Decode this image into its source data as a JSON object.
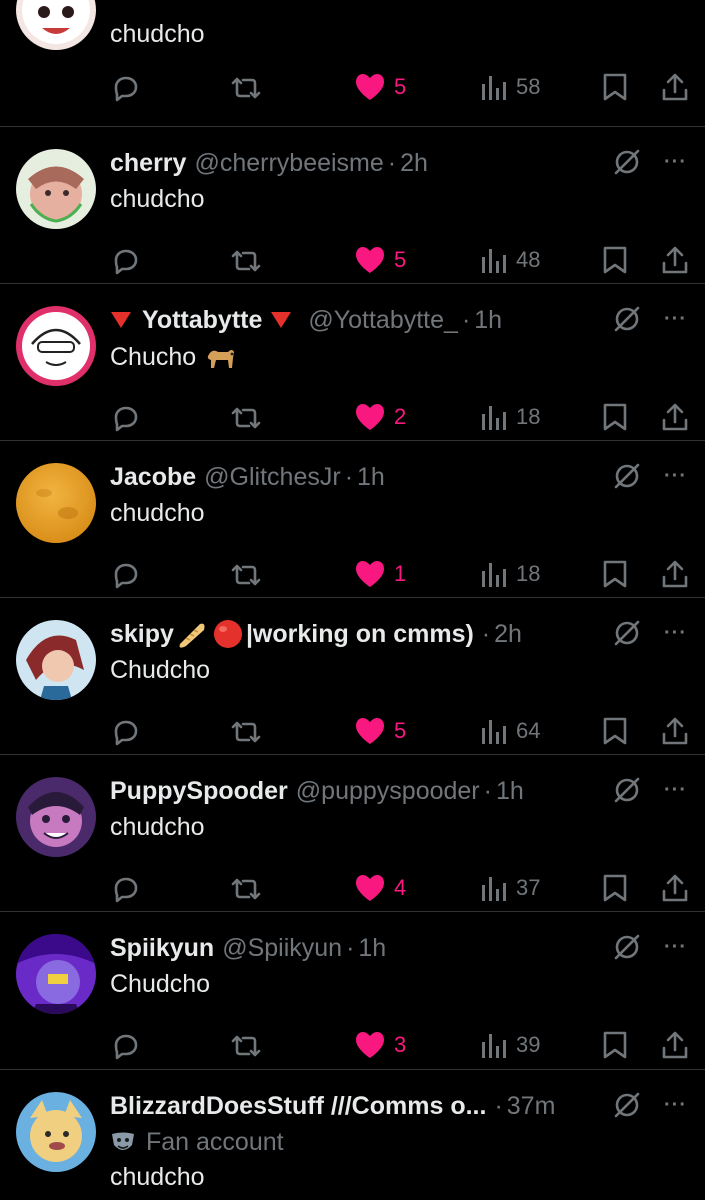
{
  "colors": {
    "accent_like": "#f91880",
    "muted": "#71767b",
    "text": "#e7e9ea",
    "divider": "#2f3336"
  },
  "tweets": [
    {
      "name": "",
      "handle": "",
      "time": "",
      "text": "chudcho",
      "replies": "",
      "retweets": "",
      "likes": "5",
      "views": "58"
    },
    {
      "name": "cherry",
      "handle": "@cherrybeeisme",
      "time": "2h",
      "text": "chudcho",
      "likes": "5",
      "views": "48"
    },
    {
      "name_prefix_emoji": "red-triangle",
      "name": "Yottabytte",
      "name_suffix_emoji": "red-triangle",
      "handle": "@Yottabytte_",
      "time": "1h",
      "text": "Chucho",
      "text_emoji": "dog",
      "likes": "2",
      "views": "18"
    },
    {
      "name": "Jacobe",
      "handle": "@GlitchesJr",
      "time": "1h",
      "text": "chudcho",
      "likes": "1",
      "views": "18"
    },
    {
      "name_prefix": "skipy",
      "name_emojis": [
        "bread",
        "red-circle"
      ],
      "name": "|working on cmms)",
      "handle": "",
      "time": "2h",
      "text": "Chudcho",
      "likes": "5",
      "views": "64"
    },
    {
      "name": "PuppySpooder",
      "handle": "@puppyspooder",
      "time": "1h",
      "text": "chudcho",
      "likes": "4",
      "views": "37"
    },
    {
      "name": "Spiikyun",
      "handle": "@Spiikyun",
      "time": "1h",
      "text": "Chudcho",
      "likes": "3",
      "views": "39"
    },
    {
      "name": "BlizzardDoesStuff ///Comms o...",
      "handle": "",
      "time": "37m",
      "label": "Fan account",
      "text": "chudcho"
    }
  ],
  "separator": "·",
  "more_glyph": "···"
}
